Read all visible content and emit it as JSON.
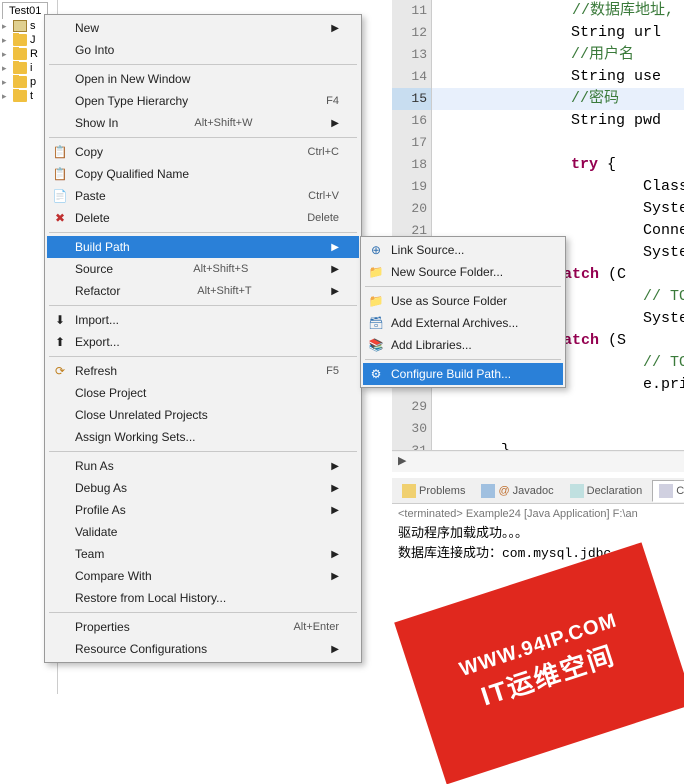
{
  "explorer": {
    "tab": "Test01",
    "items": [
      "s",
      "J",
      "R",
      "i",
      "p",
      "t"
    ]
  },
  "lines": [
    {
      "n": "11",
      "cls": "cm",
      "txt": "//数据库地址,"
    },
    {
      "n": "12",
      "cls": "",
      "txt": "String url"
    },
    {
      "n": "13",
      "cls": "cm",
      "txt": "//用户名"
    },
    {
      "n": "14",
      "cls": "",
      "txt": "String use"
    },
    {
      "n": "15",
      "cls": "cm",
      "txt": "//密码",
      "hl": true
    },
    {
      "n": "16",
      "cls": "",
      "txt": "String pwd"
    },
    {
      "n": "17",
      "cls": "",
      "txt": ""
    },
    {
      "n": "18",
      "cls": "",
      "txt": "<kw>try</kw> {"
    },
    {
      "n": "19",
      "cls": "",
      "txt": "    Class."
    },
    {
      "n": "20",
      "cls": "",
      "txt": "    System"
    },
    {
      "n": "21",
      "cls": "",
      "txt": "    Connec"
    },
    {
      "n": "22",
      "cls": "",
      "txt": "    System"
    },
    {
      "n": "23",
      "cls": "",
      "txt": "} <kw>catch</kw> (C"
    },
    {
      "n": "24",
      "cls": "cm",
      "txt": "    // TOD"
    },
    {
      "n": "25",
      "cls": "",
      "txt": "    System"
    },
    {
      "n": "26",
      "cls": "",
      "txt": "} <kw>catch</kw> (S"
    },
    {
      "n": "27",
      "cls": "cm",
      "txt": "    // TOD"
    },
    {
      "n": "28",
      "cls": "",
      "txt": "    e.prin"
    },
    {
      "n": "29",
      "cls": "",
      "txt": ""
    },
    {
      "n": "30",
      "cls": "",
      "txt": ""
    },
    {
      "n": "31",
      "cls": "",
      "txt": "}"
    }
  ],
  "breadcrumb": "▶",
  "views": {
    "problems": "Problems",
    "javadoc": "Javadoc",
    "declaration": "Declaration",
    "console": "Cons"
  },
  "console": {
    "title": "<terminated> Example24 [Java Application] F:\\an",
    "line1": "驱动程序加载成功。。。",
    "line2": "数据库连接成功：com.mysql.jdbc."
  },
  "menu1": {
    "new": "New",
    "go_into": "Go Into",
    "open_new_window": "Open in New Window",
    "open_type_hierarchy": "Open Type Hierarchy",
    "open_type_hierarchy_key": "F4",
    "show_in": "Show In",
    "show_in_key": "Alt+Shift+W",
    "copy": "Copy",
    "copy_key": "Ctrl+C",
    "copy_qualified": "Copy Qualified Name",
    "paste": "Paste",
    "paste_key": "Ctrl+V",
    "delete": "Delete",
    "delete_key": "Delete",
    "build_path": "Build Path",
    "source": "Source",
    "source_key": "Alt+Shift+S",
    "refactor": "Refactor",
    "refactor_key": "Alt+Shift+T",
    "import": "Import...",
    "export": "Export...",
    "refresh": "Refresh",
    "refresh_key": "F5",
    "close_project": "Close Project",
    "close_unrelated": "Close Unrelated Projects",
    "assign_working": "Assign Working Sets...",
    "run_as": "Run As",
    "debug_as": "Debug As",
    "profile_as": "Profile As",
    "validate": "Validate",
    "team": "Team",
    "compare_with": "Compare With",
    "restore": "Restore from Local History...",
    "properties": "Properties",
    "properties_key": "Alt+Enter",
    "resource_config": "Resource Configurations"
  },
  "menu2": {
    "link_source": "Link Source...",
    "new_source_folder": "New Source Folder...",
    "use_as_source": "Use as Source Folder",
    "add_external": "Add External Archives...",
    "add_libraries": "Add Libraries...",
    "configure": "Configure Build Path..."
  },
  "watermark": {
    "url": "WWW.94IP.COM",
    "txt": "IT运维空间"
  }
}
